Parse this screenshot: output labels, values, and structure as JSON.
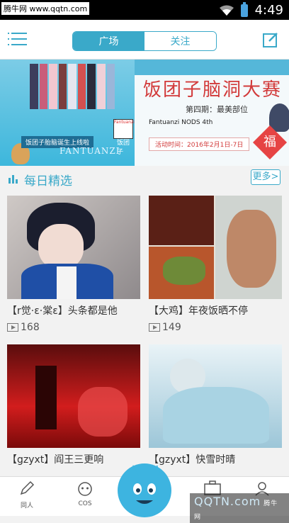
{
  "status_bar": {
    "watermark": "腾牛网 www.qqtn.com",
    "time": "4:49"
  },
  "top_bar": {
    "tabs": [
      {
        "label": "广场",
        "active": true
      },
      {
        "label": "关注",
        "active": false
      }
    ],
    "accent_color": "#3aa9c9"
  },
  "banner": {
    "left_title": "饭团子胎脑诞生上线啦",
    "left_en": "FANTUANZI",
    "logo_text": "Fantuanzi",
    "badge_label": "饭团子",
    "title": "饭团子脑洞大赛",
    "issue": "第四期：最美部位",
    "en_subtitle": "Fantuanzi NODS 4th",
    "date": "活动时间：2016年2月1日-7日",
    "fu": "福"
  },
  "section": {
    "title": "每日精选",
    "more_label": "更多>"
  },
  "cards": [
    {
      "caption": "【r觉·ε·棠ε】头条都是他",
      "views": "168"
    },
    {
      "caption": "【大鸡】年夜饭晒不停",
      "views": "149"
    },
    {
      "caption": "【gzyxt】阎王三更响",
      "views": ""
    },
    {
      "caption": "【gzyxt】快雪时晴",
      "views": ""
    }
  ],
  "tab_bar": {
    "items": [
      {
        "label": "同人",
        "icon": "pen-icon"
      },
      {
        "label": "COS",
        "icon": "cos-mask-icon"
      },
      {
        "label": "",
        "icon": "mascot-face-icon"
      },
      {
        "label": "",
        "icon": "camera-icon"
      },
      {
        "label": "",
        "icon": "profile-icon"
      }
    ]
  },
  "watermark_bottom": {
    "text": "QQTN.com",
    "small": "腾牛网"
  }
}
